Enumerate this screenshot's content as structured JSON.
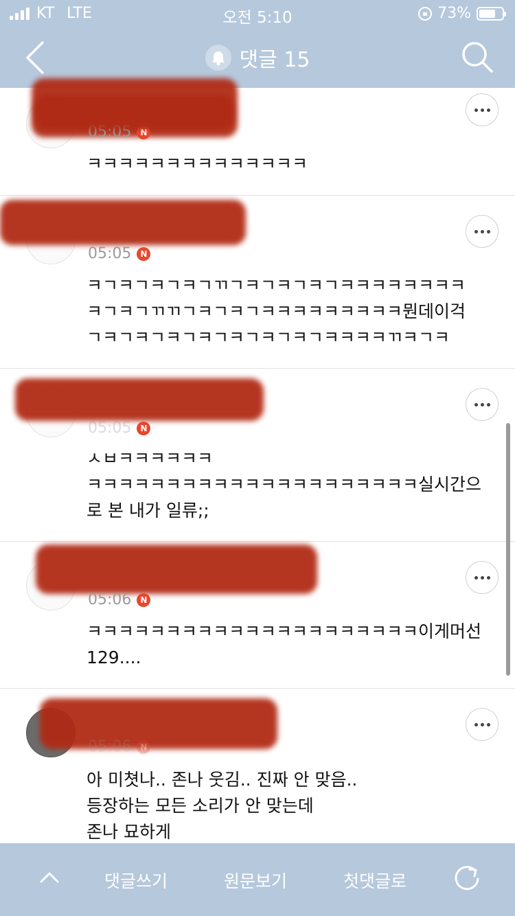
{
  "status": {
    "carrier": "KT",
    "network": "LTE",
    "time": "오전 5:10",
    "battery": "73%",
    "battery_level": 0.73
  },
  "header": {
    "title": "댓글 15"
  },
  "comments": [
    {
      "time": "05:05",
      "badge": "N",
      "text": "ㅋㅋㅋㅋㅋㅋㅋㅋㅋㅋㅋㅋㅋㅋ"
    },
    {
      "time": "05:05",
      "badge": "N",
      "text": "ㅋㄱㅋㄱㅋㄱㅋㄱㄲㄱㅋㄱㅋㄱㅋㄱㅋㅋㅋㅋㅋㅋㅋㅋ\nㅋㄱㅋㄱㄲㄲㄱㅋㄱㅋㄱㅋㅋㅋㅋㅋㅋㅋㅋㅋ뭔데이걱\nㄱㅋㄱㅋㄱㅋㄱㅋㄱㅋㄱㅋㄱㅋㄱㅋㅋㅋㅋㄲㅋㄱㅋ"
    },
    {
      "time": "05:05",
      "badge": "N",
      "text": "ㅅㅂㅋㅋㅋㅋㅋㅋ\nㅋㅋㅋㅋㅋㅋㅋㅋㅋㅋㅋㅋㅋㅋㅋㅋㅋㅋㅋㅋㅋ실시간으\n로 본 내가 일류;;"
    },
    {
      "time": "05:06",
      "badge": "N",
      "text": "ㅋㅋㅋㅋㅋㅋㅋㅋㅋㅋㅋㅋㅋㅋㅋㅋㅋㅋㅋㅋㅋ이게머선\n129...."
    },
    {
      "time": "05:06",
      "badge": "N",
      "text": "아 미쳣나.. 존나 웃김.. 진짜 안 맞음..\n등장하는 모든 소리가 안 맞는데\n존나 묘하게"
    }
  ],
  "toolbar": {
    "write": "댓글쓰기",
    "original": "원문보기",
    "first": "첫댓글로"
  },
  "icons": {
    "back": "chevron-left-icon",
    "bell": "bell-icon",
    "search": "search-icon",
    "more": "more-icon",
    "up": "chevron-up-icon",
    "refresh": "refresh-icon"
  }
}
